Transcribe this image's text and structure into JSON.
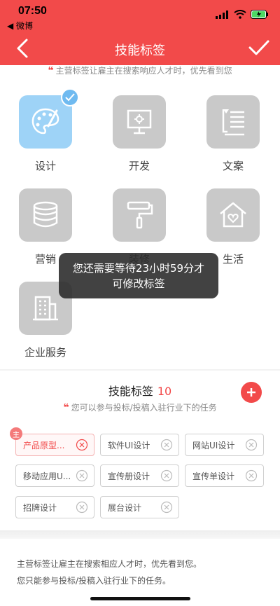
{
  "status": {
    "time": "07:50",
    "back_app": "◀ 微博"
  },
  "nav": {
    "title": "技能标签"
  },
  "hint_top": "主营标签让雇主在搜索响应人才时，优先看到您",
  "categories": [
    {
      "label": "设计",
      "icon": "palette-icon",
      "active": true
    },
    {
      "label": "开发",
      "icon": "monitor-icon"
    },
    {
      "label": "文案",
      "icon": "document-icon"
    },
    {
      "label": "营销",
      "icon": "coins-icon"
    },
    {
      "label": "装修",
      "icon": "paint-roller-icon"
    },
    {
      "label": "生活",
      "icon": "home-heart-icon"
    },
    {
      "label": "企业服务",
      "icon": "building-icon"
    }
  ],
  "toast": {
    "line1": "您还需要等待23小时59分才",
    "line2": "可修改标签"
  },
  "tags_section": {
    "title": "技能标签",
    "count": "10",
    "hint": "您可以参与投标/投稿入驻行业下的任务",
    "main_badge": "主",
    "tags": [
      "产品原型...",
      "软件UI设计",
      "网站UI设计",
      "移动应用U...",
      "宣传册设计",
      "宣传单设计",
      "招牌设计",
      "展台设计"
    ]
  },
  "bottom": {
    "line1": "主营标签让雇主在搜索相应人才时，优先看到您。",
    "line2": "您只能参与投标/投稿入驻行业下的任务。"
  },
  "colors": {
    "accent": "#f24a4a",
    "active_tile": "#9ed3f7",
    "tile": "#c9c9c9"
  }
}
